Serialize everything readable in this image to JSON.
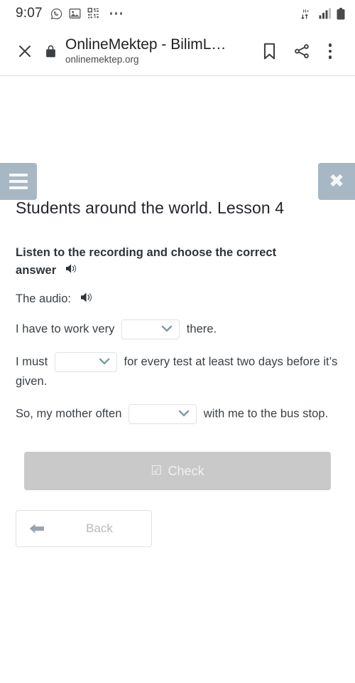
{
  "status_bar": {
    "clock": "9:07",
    "left_icons": [
      "whatsapp-icon",
      "gallery-icon",
      "qr-scan-icon",
      "overflow-dots-icon"
    ],
    "right_icons": [
      "hspa-plus-data-icon",
      "signal-bars-icon",
      "battery-icon"
    ],
    "data_label": "H+"
  },
  "browser": {
    "close_tab_label": "close-tab",
    "lock_label": "secure",
    "title": "OnlineMektep - BilimL…",
    "url": "onlinemektep.org",
    "bookmark_label": "bookmark",
    "share_label": "share",
    "menu_label": "more-options"
  },
  "page": {
    "menu_button_label": "menu",
    "close_button_label": "✖",
    "lesson_title": "Students around the world. Lesson 4",
    "task": {
      "heading": "Listen to the recording and choose the correct answer",
      "heading_audio_icon": "speaker-icon",
      "audio_label": "The audio:",
      "audio_icon": "speaker-icon"
    },
    "sentences": [
      {
        "before": "I have to work very",
        "select_value": "",
        "after": "there."
      },
      {
        "before": "I must",
        "select_value": "",
        "after": "for every test at least two days before it’s given."
      },
      {
        "before": "So, my mother often",
        "select_value": "",
        "after": "with me to the bus stop."
      }
    ],
    "check_button": {
      "label": "Check",
      "icon": "checked-checkbox-icon",
      "glyph": "☑",
      "color": "#c9c9c9"
    },
    "back_button": {
      "label": "Back",
      "icon": "arrow-left-icon"
    }
  },
  "colors": {
    "nav_button": "#a7b8c4",
    "check_button": "#c9c9c9",
    "text": "#3a4046",
    "select_border": "#dfe4e6",
    "chevron": "#7d9aa1"
  }
}
